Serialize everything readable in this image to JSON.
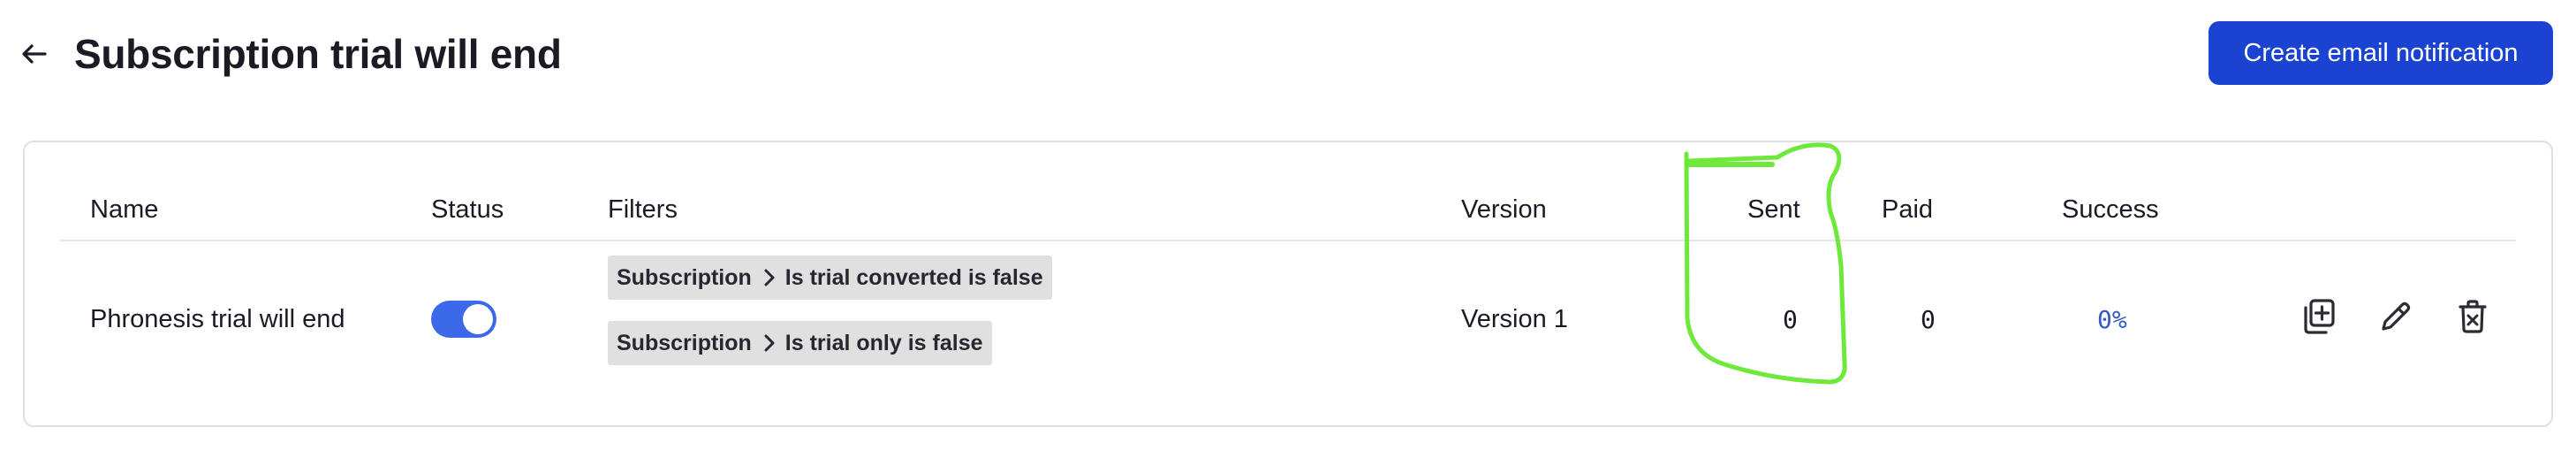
{
  "header": {
    "title": "Subscription trial will end",
    "create_button_label": "Create email notification"
  },
  "table": {
    "columns": {
      "name": "Name",
      "status": "Status",
      "filters": "Filters",
      "version": "Version",
      "sent": "Sent",
      "paid": "Paid",
      "success": "Success"
    },
    "rows": [
      {
        "name": "Phronesis trial will end",
        "status_enabled": true,
        "filters": [
          {
            "entity": "Subscription",
            "condition": "Is trial converted is false"
          },
          {
            "entity": "Subscription",
            "condition": "Is trial only is false"
          }
        ],
        "version": "Version 1",
        "sent": "0",
        "paid": "0",
        "success": "0%"
      }
    ]
  },
  "colors": {
    "primary_button": "#1a43d1",
    "toggle_on": "#3c69ea",
    "success_text": "#3559c7",
    "annotation": "#6ee83b"
  },
  "icons": {
    "back": "arrow-left-icon",
    "duplicate": "duplicate-icon",
    "edit": "pencil-icon",
    "delete": "trash-icon",
    "chevron": "chevron-right-icon"
  }
}
